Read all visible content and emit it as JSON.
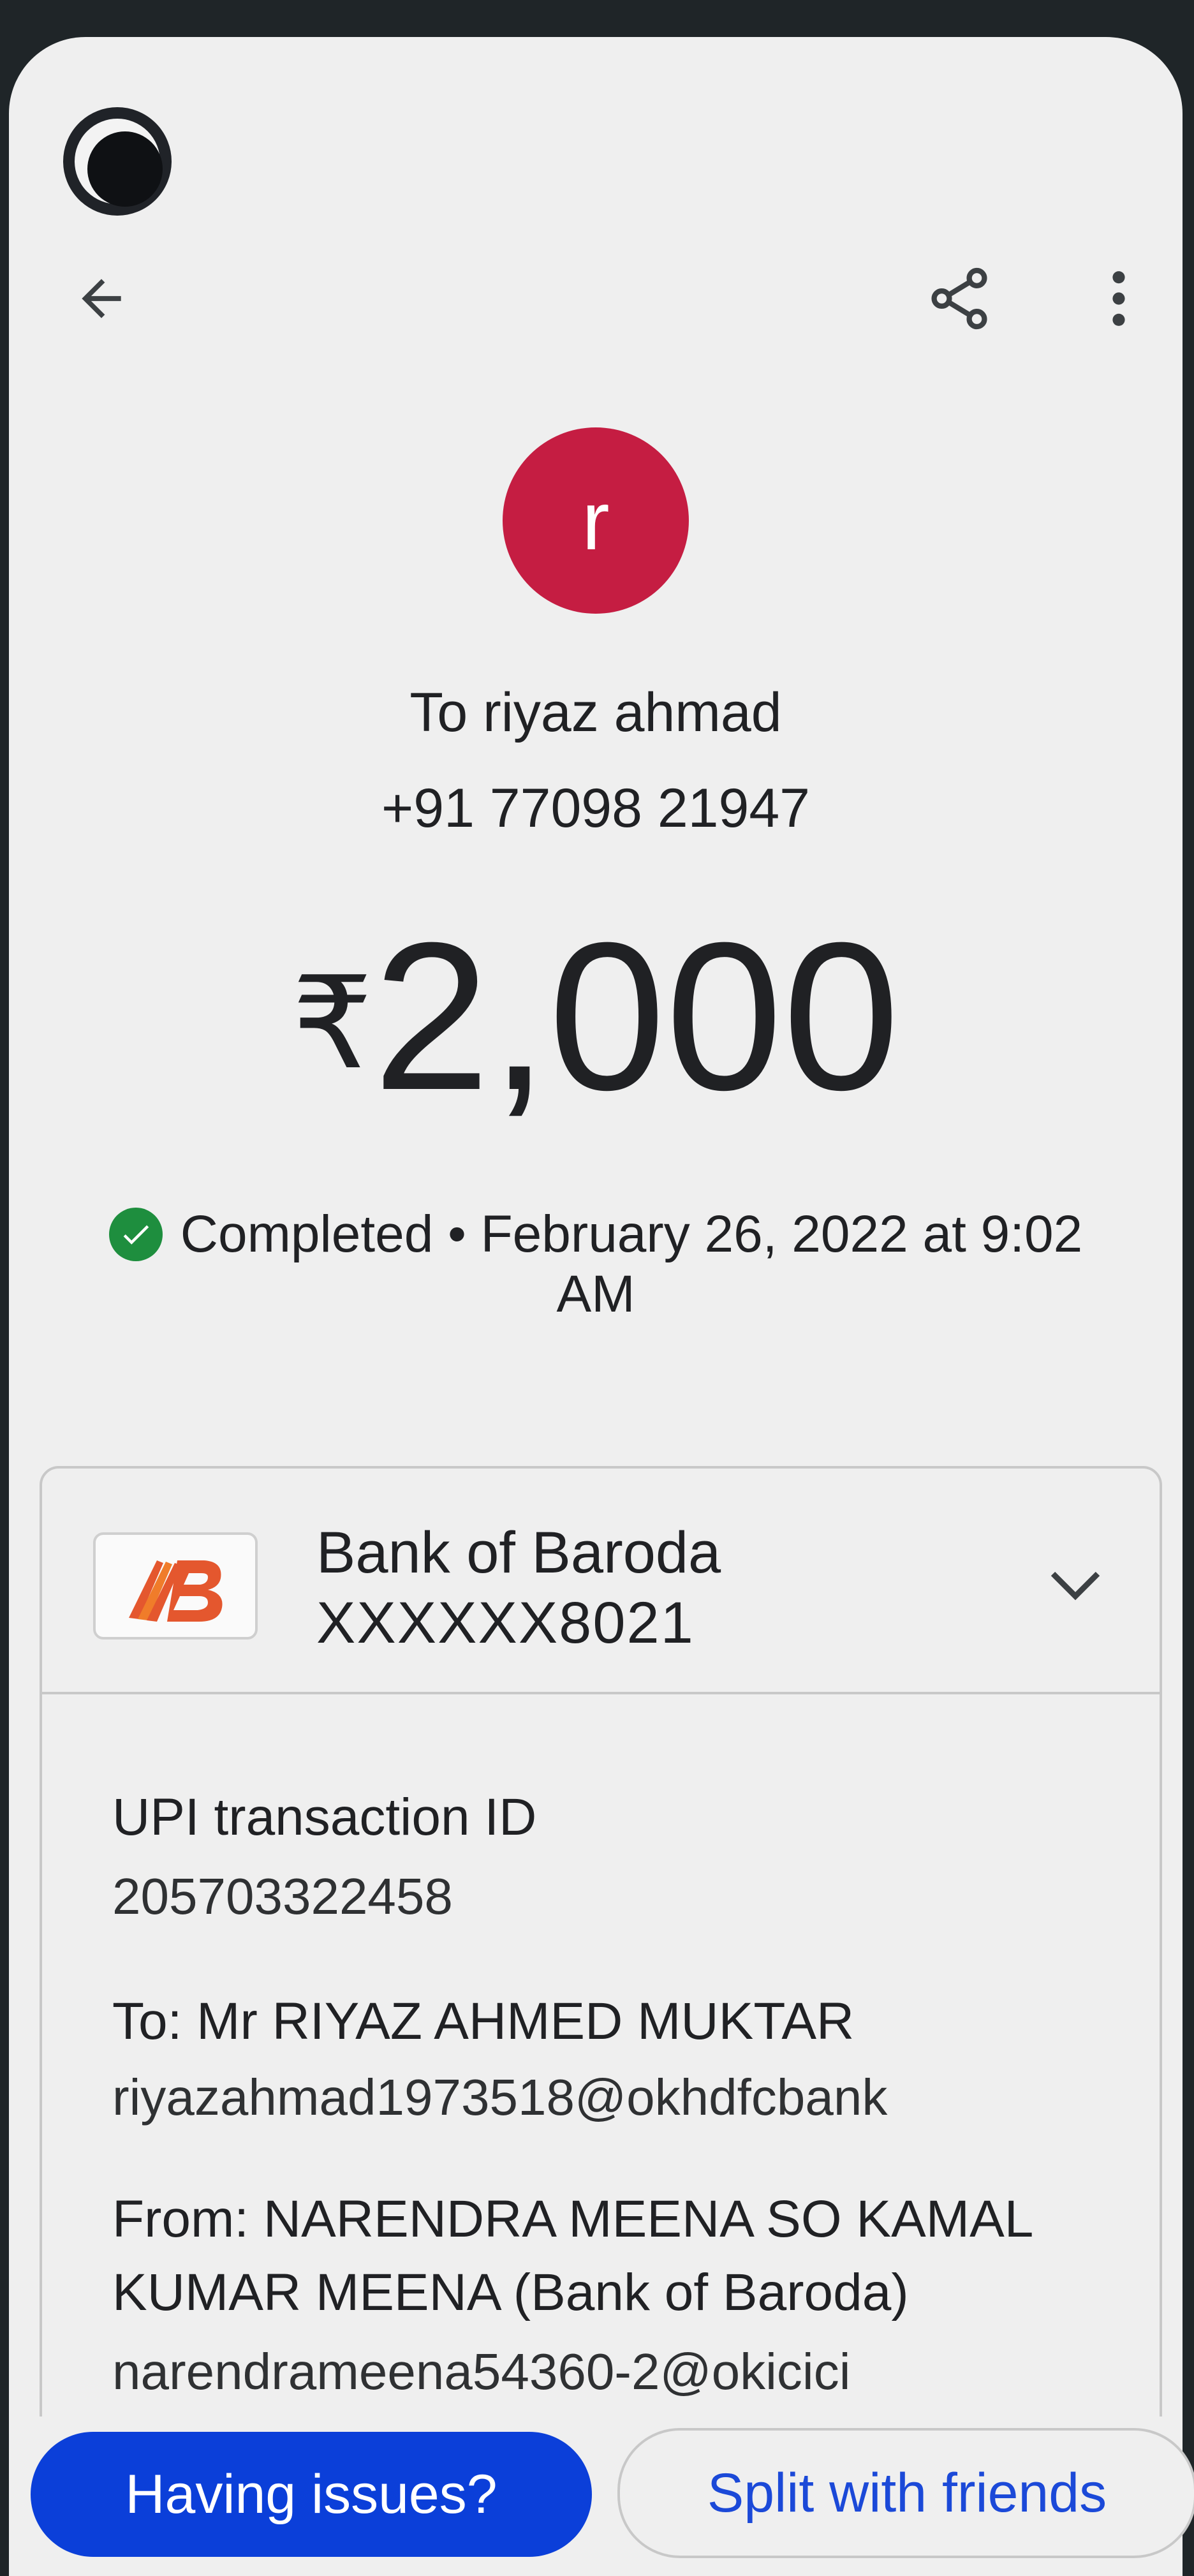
{
  "header": {
    "back_icon": "arrow-left-icon",
    "share_icon": "share-icon",
    "more_icon": "more-vert-icon"
  },
  "recipient": {
    "avatar_letter": "r",
    "avatar_color": "#c51d42",
    "to": "To riyaz ahmad",
    "phone": "+91 77098 21947"
  },
  "amount": {
    "currency": "₹",
    "value": "2,000"
  },
  "status": {
    "line1": "Completed • February 26, 2022 at 9:02",
    "line2": "AM",
    "icon": "check-circle-icon",
    "color": "#1e8e3e"
  },
  "account": {
    "bank_name": "Bank of Baroda",
    "account_number": "XXXXXX8021",
    "logo": "bank-of-baroda-logo"
  },
  "details": {
    "upi_label": "UPI transaction ID",
    "upi_id": "205703322458",
    "to_label": "To: Mr RIYAZ AHMED MUKTAR",
    "to_upi": "riyazahmad1973518@okhdfcbank",
    "from_label_line1": "From: NARENDRA MEENA SO KAMAL",
    "from_label_line2": "KUMAR MEENA (Bank of Baroda)",
    "from_upi": "narendrameena54360-2@okicici"
  },
  "actions": {
    "issues": "Having issues?",
    "split": "Split with friends"
  }
}
